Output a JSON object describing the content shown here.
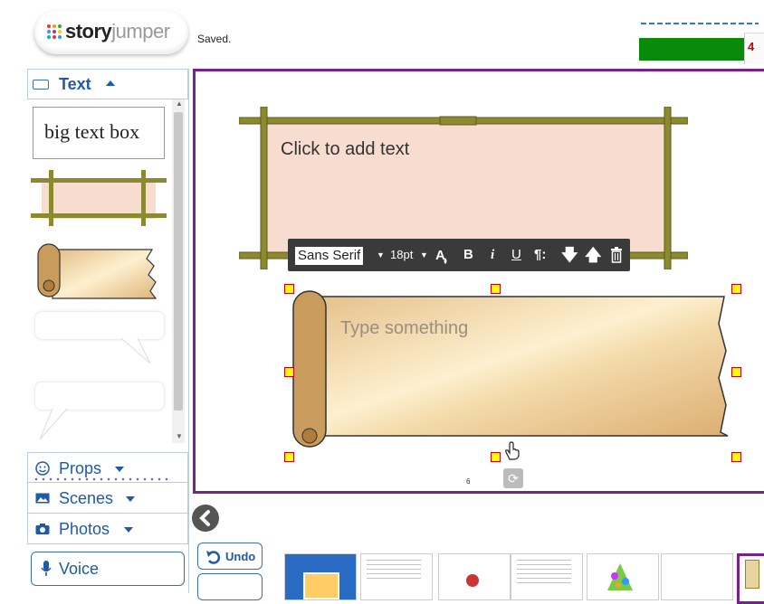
{
  "header": {
    "logo_text_a": "story",
    "logo_text_b": "jumper",
    "save_status": "Saved.",
    "progress_label": "4"
  },
  "sidebar": {
    "section_title": "Text",
    "big_text_box": "big text box",
    "menu": [
      {
        "label": "Props"
      },
      {
        "label": "Scenes"
      },
      {
        "label": "Photos"
      }
    ],
    "voice_label": "Voice"
  },
  "canvas": {
    "bamboo_placeholder": "Click to add text",
    "scroll_placeholder": "Type something",
    "page_number": "6"
  },
  "toolbar": {
    "font": "Sans Serif",
    "size": "18pt",
    "bold": "B",
    "italic": "i",
    "underline": "U",
    "paragraph": "¶:"
  },
  "bottom": {
    "undo_label": "Undo"
  },
  "colors": {
    "accent": "#1e5aa8",
    "canvas_border": "#7a1f8f",
    "progress": "#0a8a0a"
  }
}
